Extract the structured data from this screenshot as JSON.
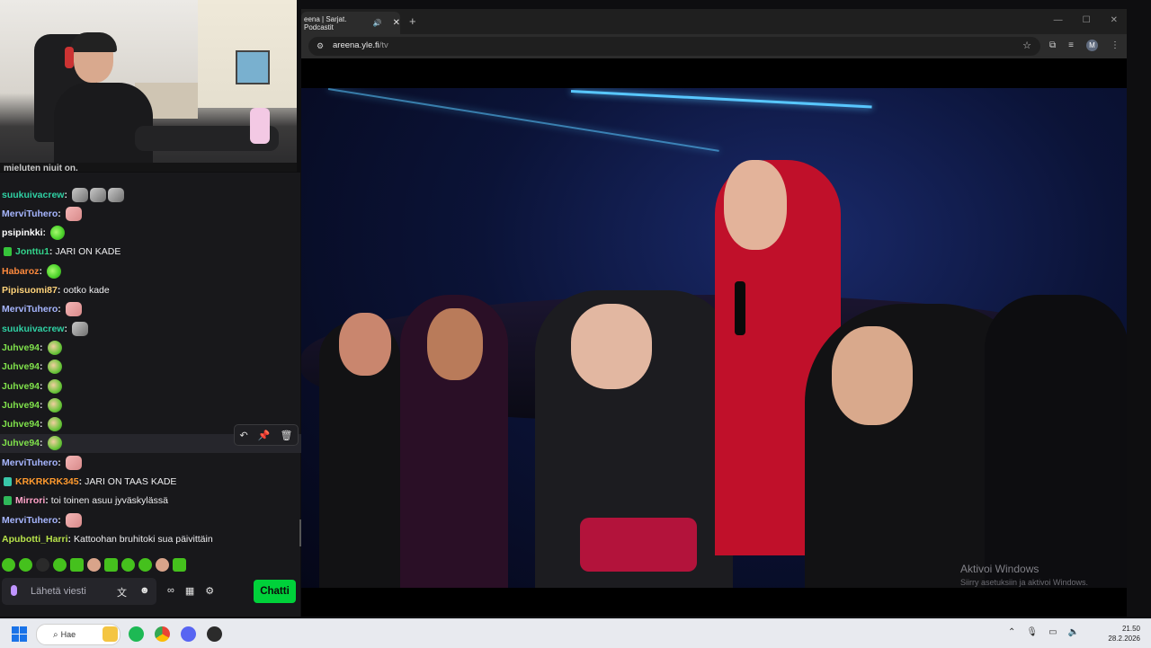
{
  "webcam": {
    "caption_cut": "mieluten niuit on."
  },
  "chat": {
    "messages": [
      {
        "user": "suukuivacrew",
        "color": "#2fd1a4",
        "text": "",
        "emotes": [
          "gray",
          "gray",
          "gray"
        ],
        "badge": null
      },
      {
        "user": "MerviTuhero",
        "color": "#a7b6ff",
        "text": "",
        "emotes": [
          "pink"
        ],
        "badge": null
      },
      {
        "user": "psipinkki",
        "color": "#ffffff",
        "text": "",
        "emotes": [
          "green"
        ],
        "badge": null
      },
      {
        "user": "Jonttu1",
        "color": "#33d38b",
        "text": "JARI ON KADE",
        "emotes": [],
        "badge": "#36c43a"
      },
      {
        "user": "Habaroz",
        "color": "#ff8a3d",
        "text": "",
        "emotes": [
          "green"
        ],
        "badge": null
      },
      {
        "user": "Pipisuomi87",
        "color": "#ffd37a",
        "text": "ootko kade",
        "emotes": [],
        "badge": null
      },
      {
        "user": "MerviTuhero",
        "color": "#a7b6ff",
        "text": "",
        "emotes": [
          "pink"
        ],
        "badge": null
      },
      {
        "user": "suukuivacrew",
        "color": "#2fd1a4",
        "text": "",
        "emotes": [
          "gray"
        ],
        "badge": null
      },
      {
        "user": "Juhve94",
        "color": "#7fe04b",
        "text": "",
        "emotes": [
          "wg"
        ],
        "badge": null
      },
      {
        "user": "Juhve94",
        "color": "#7fe04b",
        "text": "",
        "emotes": [
          "wg"
        ],
        "badge": null
      },
      {
        "user": "Juhve94",
        "color": "#7fe04b",
        "text": "",
        "emotes": [
          "wg"
        ],
        "badge": null
      },
      {
        "user": "Juhve94",
        "color": "#7fe04b",
        "text": "",
        "emotes": [
          "wg"
        ],
        "badge": null
      },
      {
        "user": "Juhve94",
        "color": "#7fe04b",
        "text": "",
        "emotes": [
          "wg"
        ],
        "badge": null
      },
      {
        "user": "Juhve94",
        "color": "#7fe04b",
        "text": "",
        "emotes": [
          "wg"
        ],
        "badge": null
      },
      {
        "user": "MerviTuhero",
        "color": "#a7b6ff",
        "text": "",
        "emotes": [
          "pink"
        ],
        "badge": null
      },
      {
        "user": "KRKRKRK345",
        "color": "#ff9a2e",
        "text": "JARI ON TAAS KADE",
        "emotes": [],
        "badge": "#39c7a9"
      },
      {
        "user": "Mirrori",
        "color": "#ffa2c8",
        "text": "toi toinen asuu jyväskylässä",
        "emotes": [],
        "badge": "#2fb85a"
      },
      {
        "user": "MerviTuhero",
        "color": "#a7b6ff",
        "text": "",
        "emotes": [
          "pink"
        ],
        "badge": null
      },
      {
        "user": "Apubotti_Harri",
        "color": "#b7e24a",
        "text": "Kattoohan bruhitoki sua päivittäin",
        "emotes": [],
        "badge": null
      }
    ],
    "hover_tools": [
      "↶",
      "📌",
      "🗑"
    ],
    "input_placeholder": "Lähetä viesti",
    "send_label": "Chatti"
  },
  "browser": {
    "tab_title": "eena | Sarjat. Podcastit",
    "url_host": "areena.yle.fi",
    "url_path": "/tv",
    "avatar_letter": "M",
    "new_tab": "+"
  },
  "video": {
    "watermark_title": "Aktivoi Windows",
    "watermark_sub": "Siirry asetuksiin ja aktivoi Windows."
  },
  "taskbar": {
    "search_label": "Hae",
    "time": "21.50",
    "date": "28.2.2026"
  }
}
